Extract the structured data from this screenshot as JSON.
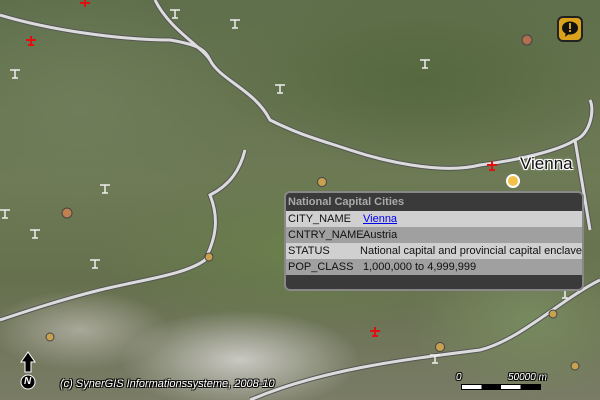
{
  "map": {
    "city_label": "Vienna",
    "copyright": "(c) SynerGIS Informationssysteme, 2008-10",
    "scale": {
      "start": "0",
      "end": "50000 m"
    },
    "north_label": "N"
  },
  "popup": {
    "title": "National Capital Cities",
    "rows": [
      {
        "key": "CITY_NAME",
        "value": "Vienna",
        "link": true
      },
      {
        "key": "CNTRY_NAME",
        "value": "Austria"
      },
      {
        "key": "STATUS",
        "value": "National capital and provincial capital enclave"
      },
      {
        "key": "POP_CLASS",
        "value": "1,000,000 to 4,999,999"
      }
    ]
  },
  "icons": [
    "north-arrow-icon",
    "notice-icon",
    "airport-icon",
    "city-dot-icon"
  ],
  "colors": {
    "border": "#d8d8d8",
    "city_dot": "#c8a050",
    "capital": "#f3c04a",
    "airport_red": "#e01010"
  }
}
